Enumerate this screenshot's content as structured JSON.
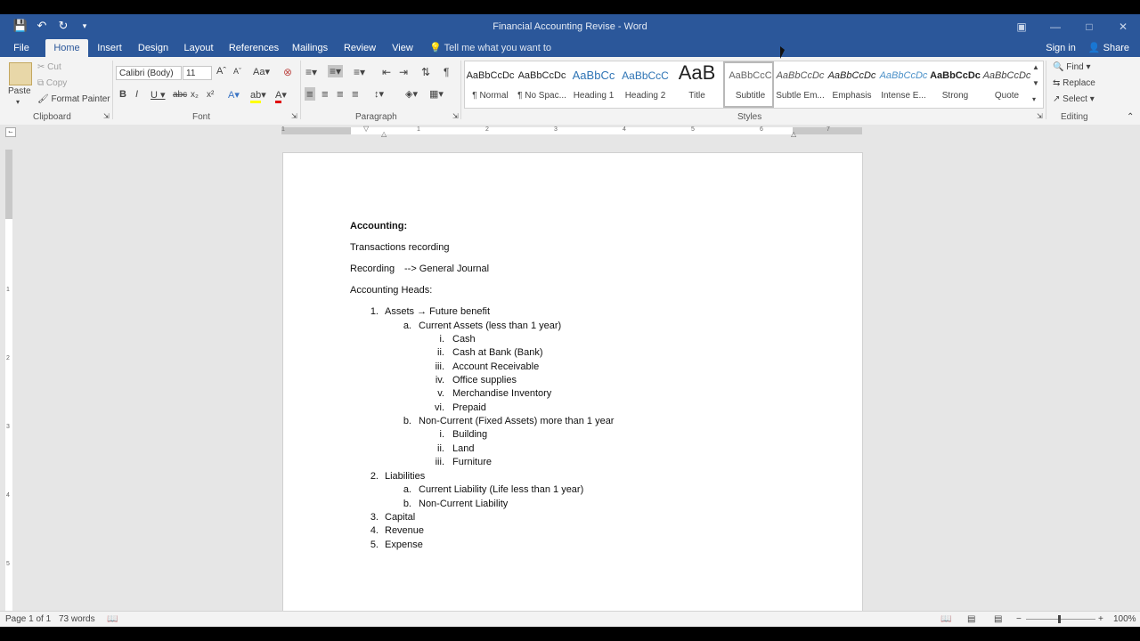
{
  "window": {
    "title": "Financial Accounting Revise - Word"
  },
  "tabs": [
    "File",
    "Home",
    "Insert",
    "Design",
    "Layout",
    "References",
    "Mailings",
    "Review",
    "View"
  ],
  "tell_me": "Tell me what you want to do...",
  "account": {
    "sign_in": "Sign in",
    "share": "Share"
  },
  "clipboard": {
    "paste": "Paste",
    "cut": "Cut",
    "copy": "Copy",
    "format_painter": "Format Painter",
    "label": "Clipboard"
  },
  "font": {
    "name": "Calibri (Body)",
    "size": "11",
    "label": "Font"
  },
  "paragraph": {
    "label": "Paragraph"
  },
  "styles": {
    "label": "Styles",
    "items": [
      {
        "preview": "AaBbCcDc",
        "name": "¶ Normal"
      },
      {
        "preview": "AaBbCcDc",
        "name": "¶ No Spac..."
      },
      {
        "preview": "AaBbCc",
        "name": "Heading 1"
      },
      {
        "preview": "AaBbCcC",
        "name": "Heading 2"
      },
      {
        "preview": "AaB",
        "name": "Title"
      },
      {
        "preview": "AaBbCcC",
        "name": "Subtitle"
      },
      {
        "preview": "AaBbCcDc",
        "name": "Subtle Em..."
      },
      {
        "preview": "AaBbCcDc",
        "name": "Emphasis"
      },
      {
        "preview": "AaBbCcDc",
        "name": "Intense E..."
      },
      {
        "preview": "AaBbCcDc",
        "name": "Strong"
      },
      {
        "preview": "AaBbCcDc",
        "name": "Quote"
      }
    ]
  },
  "editing": {
    "find": "Find",
    "replace": "Replace",
    "select": "Select",
    "label": "Editing"
  },
  "ruler": {
    "h_ticks": [
      "1",
      "1",
      "2",
      "3",
      "4",
      "5",
      "6",
      "7"
    ],
    "v_ticks": [
      "1",
      "2",
      "3",
      "4",
      "5"
    ]
  },
  "document": {
    "heading": "Accounting:",
    "p1": "Transactions recording",
    "p2_left": "Recording",
    "p2_right": "--> General Journal",
    "p3": "Accounting Heads:",
    "list": [
      {
        "level": 1,
        "marker": "1.",
        "text": "Assets",
        "arrow": "→",
        "suffix": "Future benefit"
      },
      {
        "level": 2,
        "marker": "a.",
        "text": "Current Assets (less than 1 year)"
      },
      {
        "level": 3,
        "marker": "i.",
        "text": "Cash"
      },
      {
        "level": 3,
        "marker": "ii.",
        "text": "Cash at Bank (Bank)"
      },
      {
        "level": 3,
        "marker": "iii.",
        "text": "Account Receivable"
      },
      {
        "level": 3,
        "marker": "iv.",
        "text": "Office supplies"
      },
      {
        "level": 3,
        "marker": "v.",
        "text": "Merchandise Inventory"
      },
      {
        "level": 3,
        "marker": "vi.",
        "text": "Prepaid"
      },
      {
        "level": 2,
        "marker": "b.",
        "text": "Non-Current (Fixed Assets) more than 1 year"
      },
      {
        "level": 3,
        "marker": "i.",
        "text": "Building"
      },
      {
        "level": 3,
        "marker": "ii.",
        "text": "Land"
      },
      {
        "level": 3,
        "marker": "iii.",
        "text": "Furniture"
      },
      {
        "level": 1,
        "marker": "2.",
        "text": "Liabilities"
      },
      {
        "level": 2,
        "marker": "a.",
        "text": "Current Liability (Life less than 1 year)"
      },
      {
        "level": 2,
        "marker": "b.",
        "text": "Non-Current Liability"
      },
      {
        "level": 1,
        "marker": "3.",
        "text": "Capital"
      },
      {
        "level": 1,
        "marker": "4.",
        "text": "Revenue"
      },
      {
        "level": 1,
        "marker": "5.",
        "text": "Expense"
      }
    ]
  },
  "status": {
    "page": "Page 1 of 1",
    "words": "73 words",
    "zoom": "100%"
  },
  "colors": {
    "brand": "#2b579a",
    "ribbon": "#f3f3f3",
    "canvas": "#e6e6e6"
  }
}
